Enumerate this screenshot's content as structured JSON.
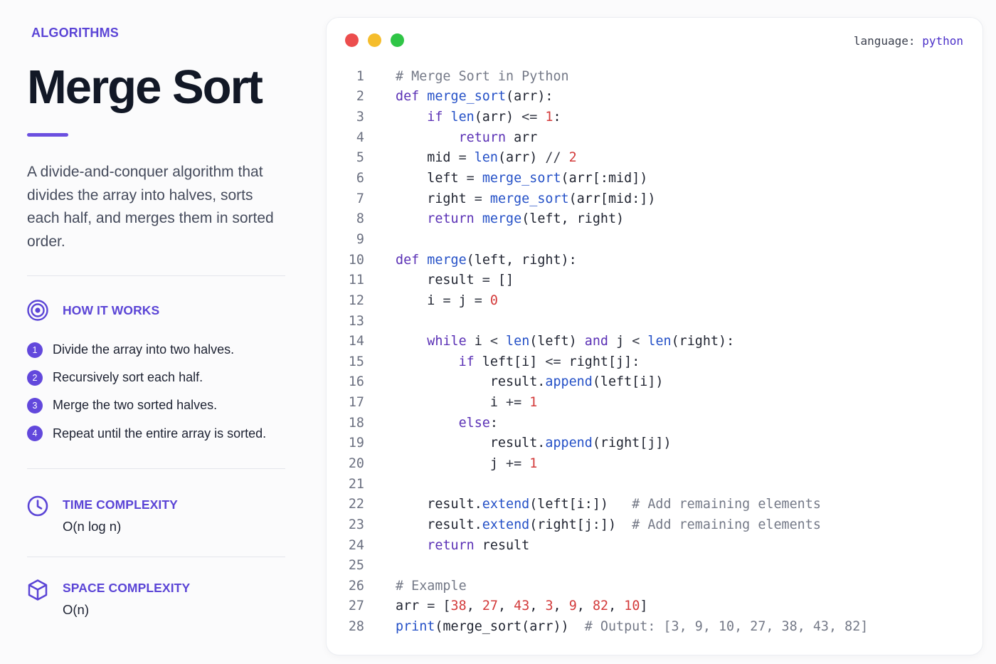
{
  "sidebar": {
    "eyebrow": "ALGORITHMS",
    "title": "Merge Sort",
    "description": "A divide-and-conquer algorithm that divides the array into halves, sorts each half, and merges them in sorted order.",
    "how_it_works": {
      "heading": "HOW IT WORKS",
      "icon": "target-icon",
      "steps": [
        {
          "number": "1",
          "text": "Divide the array into two halves."
        },
        {
          "number": "2",
          "text": "Recursively sort each half."
        },
        {
          "number": "3",
          "text": "Merge the two sorted halves."
        },
        {
          "number": "4",
          "text": "Repeat until the entire array is sorted."
        }
      ]
    },
    "time_complexity": {
      "heading": "TIME COMPLEXITY",
      "value": "O(n log n)",
      "icon": "clock-icon"
    },
    "space_complexity": {
      "heading": "SPACE COMPLEXITY",
      "value": "O(n)",
      "icon": "cube-icon"
    }
  },
  "code_panel": {
    "window_controls": [
      "close-dot",
      "minimize-dot",
      "maximize-dot"
    ],
    "language_label": "language:",
    "language_value": "python",
    "lines": [
      [
        [
          "cm",
          "# Merge Sort in Python"
        ]
      ],
      [
        [
          "kw",
          "def "
        ],
        [
          "fn",
          "merge_sort"
        ],
        [
          "pl",
          "(arr):"
        ]
      ],
      [
        [
          "pl",
          "    "
        ],
        [
          "kw",
          "if "
        ],
        [
          "fn",
          "len"
        ],
        [
          "pl",
          "(arr) "
        ],
        [
          "op",
          "<="
        ],
        [
          "pl",
          " "
        ],
        [
          "num",
          "1"
        ],
        [
          "pl",
          ":"
        ]
      ],
      [
        [
          "pl",
          "        "
        ],
        [
          "kw",
          "return"
        ],
        [
          "pl",
          " arr"
        ]
      ],
      [
        [
          "pl",
          "    mid "
        ],
        [
          "op",
          "="
        ],
        [
          "pl",
          " "
        ],
        [
          "fn",
          "len"
        ],
        [
          "pl",
          "(arr) "
        ],
        [
          "op",
          "//"
        ],
        [
          "pl",
          " "
        ],
        [
          "num",
          "2"
        ]
      ],
      [
        [
          "pl",
          "    left "
        ],
        [
          "op",
          "="
        ],
        [
          "pl",
          " "
        ],
        [
          "fn",
          "merge_sort"
        ],
        [
          "pl",
          "(arr[:mid])"
        ]
      ],
      [
        [
          "pl",
          "    right "
        ],
        [
          "op",
          "="
        ],
        [
          "pl",
          " "
        ],
        [
          "fn",
          "merge_sort"
        ],
        [
          "pl",
          "(arr[mid:])"
        ]
      ],
      [
        [
          "pl",
          "    "
        ],
        [
          "kw",
          "return"
        ],
        [
          "pl",
          " "
        ],
        [
          "fn",
          "merge"
        ],
        [
          "pl",
          "(left, right)"
        ]
      ],
      [],
      [
        [
          "kw",
          "def "
        ],
        [
          "fn",
          "merge"
        ],
        [
          "pl",
          "(left, right):"
        ]
      ],
      [
        [
          "pl",
          "    result "
        ],
        [
          "op",
          "="
        ],
        [
          "pl",
          " []"
        ]
      ],
      [
        [
          "pl",
          "    i "
        ],
        [
          "op",
          "="
        ],
        [
          "pl",
          " j "
        ],
        [
          "op",
          "="
        ],
        [
          "pl",
          " "
        ],
        [
          "num",
          "0"
        ]
      ],
      [],
      [
        [
          "pl",
          "    "
        ],
        [
          "kw",
          "while"
        ],
        [
          "pl",
          " i "
        ],
        [
          "op",
          "<"
        ],
        [
          "pl",
          " "
        ],
        [
          "fn",
          "len"
        ],
        [
          "pl",
          "(left) "
        ],
        [
          "kw",
          "and"
        ],
        [
          "pl",
          " j "
        ],
        [
          "op",
          "<"
        ],
        [
          "pl",
          " "
        ],
        [
          "fn",
          "len"
        ],
        [
          "pl",
          "(right):"
        ]
      ],
      [
        [
          "pl",
          "        "
        ],
        [
          "kw",
          "if"
        ],
        [
          "pl",
          " left[i] "
        ],
        [
          "op",
          "<="
        ],
        [
          "pl",
          " right[j]:"
        ]
      ],
      [
        [
          "pl",
          "            result."
        ],
        [
          "fn",
          "append"
        ],
        [
          "pl",
          "(left[i])"
        ]
      ],
      [
        [
          "pl",
          "            i "
        ],
        [
          "op",
          "+="
        ],
        [
          "pl",
          " "
        ],
        [
          "num",
          "1"
        ]
      ],
      [
        [
          "pl",
          "        "
        ],
        [
          "kw",
          "else"
        ],
        [
          "pl",
          ":"
        ]
      ],
      [
        [
          "pl",
          "            result."
        ],
        [
          "fn",
          "append"
        ],
        [
          "pl",
          "(right[j])"
        ]
      ],
      [
        [
          "pl",
          "            j "
        ],
        [
          "op",
          "+="
        ],
        [
          "pl",
          " "
        ],
        [
          "num",
          "1"
        ]
      ],
      [],
      [
        [
          "pl",
          "    result."
        ],
        [
          "fn",
          "extend"
        ],
        [
          "pl",
          "(left[i:])   "
        ],
        [
          "cm",
          "# Add remaining elements"
        ]
      ],
      [
        [
          "pl",
          "    result."
        ],
        [
          "fn",
          "extend"
        ],
        [
          "pl",
          "(right[j:])  "
        ],
        [
          "cm",
          "# Add remaining elements"
        ]
      ],
      [
        [
          "pl",
          "    "
        ],
        [
          "kw",
          "return"
        ],
        [
          "pl",
          " result"
        ]
      ],
      [],
      [
        [
          "cm",
          "# Example"
        ]
      ],
      [
        [
          "pl",
          "arr "
        ],
        [
          "op",
          "="
        ],
        [
          "pl",
          " ["
        ],
        [
          "num",
          "38"
        ],
        [
          "pl",
          ", "
        ],
        [
          "num",
          "27"
        ],
        [
          "pl",
          ", "
        ],
        [
          "num",
          "43"
        ],
        [
          "pl",
          ", "
        ],
        [
          "num",
          "3"
        ],
        [
          "pl",
          ", "
        ],
        [
          "num",
          "9"
        ],
        [
          "pl",
          ", "
        ],
        [
          "num",
          "82"
        ],
        [
          "pl",
          ", "
        ],
        [
          "num",
          "10"
        ],
        [
          "pl",
          "]"
        ]
      ],
      [
        [
          "fn",
          "print"
        ],
        [
          "pl",
          "(merge_sort(arr))  "
        ],
        [
          "cm",
          "# Output: [3, 9, 10, 27, 38, 43, 82]"
        ]
      ]
    ]
  },
  "colors": {
    "accent": "#5b45d6",
    "title": "#121826",
    "dot_close": "#ec4d4d",
    "dot_minimize": "#f5bd2c",
    "dot_maximize": "#2fc546",
    "keyword": "#5a30b5",
    "function": "#2450c7",
    "number": "#d33a3a",
    "comment": "#747987"
  }
}
